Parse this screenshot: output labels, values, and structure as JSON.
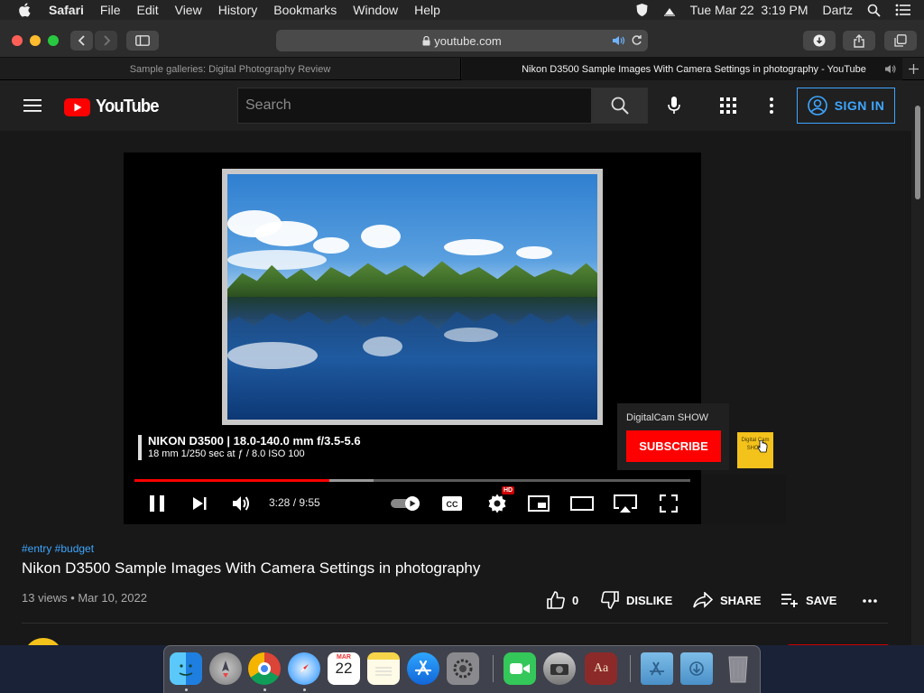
{
  "menubar": {
    "app_name": "Safari",
    "items": [
      "File",
      "Edit",
      "View",
      "History",
      "Bookmarks",
      "Window",
      "Help"
    ],
    "datetime": "Tue Mar 22  3:19 PM",
    "user": "Dartz"
  },
  "browser": {
    "url": "youtube.com",
    "tabs": [
      {
        "title": "Sample galleries: Digital Photography Review",
        "active": false
      },
      {
        "title": "Nikon D3500 Sample Images With Camera Settings in photography - YouTube",
        "active": true
      }
    ]
  },
  "youtube": {
    "logo_text": "YouTube",
    "search_placeholder": "Search",
    "sign_in_label": "SIGN IN"
  },
  "player": {
    "overlay_title": "NIKON D3500 | 18.0-140.0 mm f/3.5-5.6",
    "overlay_subtitle": "18 mm 1/250 sec at ƒ / 8.0 ISO 100",
    "channel_card_name": "DigitalCam SHOW",
    "subscribe_label": "SUBSCRIBE",
    "channel_thumb_text": "Digital Cam SHOW",
    "time_display": "3:28 / 9:55",
    "progress_fraction": 0.35,
    "hd_badge": "HD"
  },
  "video": {
    "hashtags": "#entry #budget",
    "title": "Nikon D3500 Sample Images With Camera Settings in photography",
    "views_date": "13 views • Mar 10, 2022",
    "like_count": "0",
    "dislike_label": "DISLIKE",
    "share_label": "SHARE",
    "save_label": "SAVE"
  },
  "dock": {
    "icons": [
      "finder-icon",
      "launchpad-icon",
      "chrome-icon",
      "safari-icon",
      "calendar-icon",
      "notes-icon",
      "app-store-icon",
      "system-preferences-icon",
      "facetime-icon",
      "screenshot-icon",
      "dictionary-icon",
      "applications-folder-icon",
      "downloads-folder-icon",
      "trash-icon"
    ],
    "calendar_month": "MAR",
    "calendar_day": "22",
    "dictionary_text": "Aa"
  },
  "colors": {
    "youtube_red": "#ff0000",
    "link_blue": "#3ea6ff",
    "background": "#181818"
  }
}
